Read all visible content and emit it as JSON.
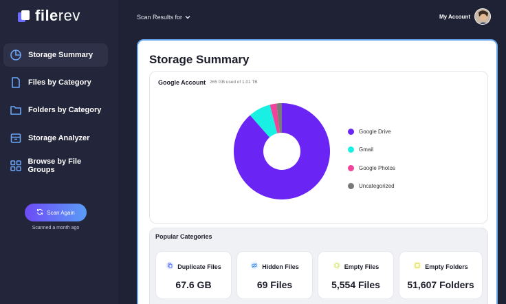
{
  "brand": {
    "name_bold": "file",
    "name_light": "rev"
  },
  "sidebar": {
    "items": [
      {
        "label": "Storage Summary",
        "icon": "pie-chart-icon",
        "active": true
      },
      {
        "label": "Files by Category",
        "icon": "file-icon",
        "active": false
      },
      {
        "label": "Folders by Category",
        "icon": "folder-icon",
        "active": false
      },
      {
        "label": "Storage Analyzer",
        "icon": "archive-icon",
        "active": false
      },
      {
        "label": "Browse by File Groups",
        "icon": "grid-icon",
        "active": false
      }
    ],
    "scan_button": "Scan Again",
    "scanned_text": "Scanned a month ago"
  },
  "header": {
    "scan_results_label": "Scan Results for",
    "account_label": "My Account"
  },
  "main": {
    "title": "Storage Summary",
    "account_card": {
      "title": "Google Account",
      "usage": "265 GB used of 1.01 TB"
    },
    "popular": {
      "title": "Popular Categories",
      "tiles": [
        {
          "label": "Duplicate Files",
          "value": "67.6 GB",
          "icon": "duplicate-icon"
        },
        {
          "label": "Hidden Files",
          "value": "69 Files",
          "icon": "hidden-icon"
        },
        {
          "label": "Empty Files",
          "value": "5,554 Files",
          "icon": "empty-file-icon"
        },
        {
          "label": "Empty Folders",
          "value": "51,607 Folders",
          "icon": "empty-folder-icon"
        }
      ]
    }
  },
  "chart_data": {
    "type": "pie",
    "donut": true,
    "categories": [
      "Google Drive",
      "Gmail",
      "Google Photos",
      "Uncategorized"
    ],
    "values": [
      88.5,
      7.5,
      2.2,
      1.8
    ],
    "colors": [
      "#6a25f5",
      "#19f0e3",
      "#f0449a",
      "#7a7a7a"
    ],
    "legend": "right"
  }
}
